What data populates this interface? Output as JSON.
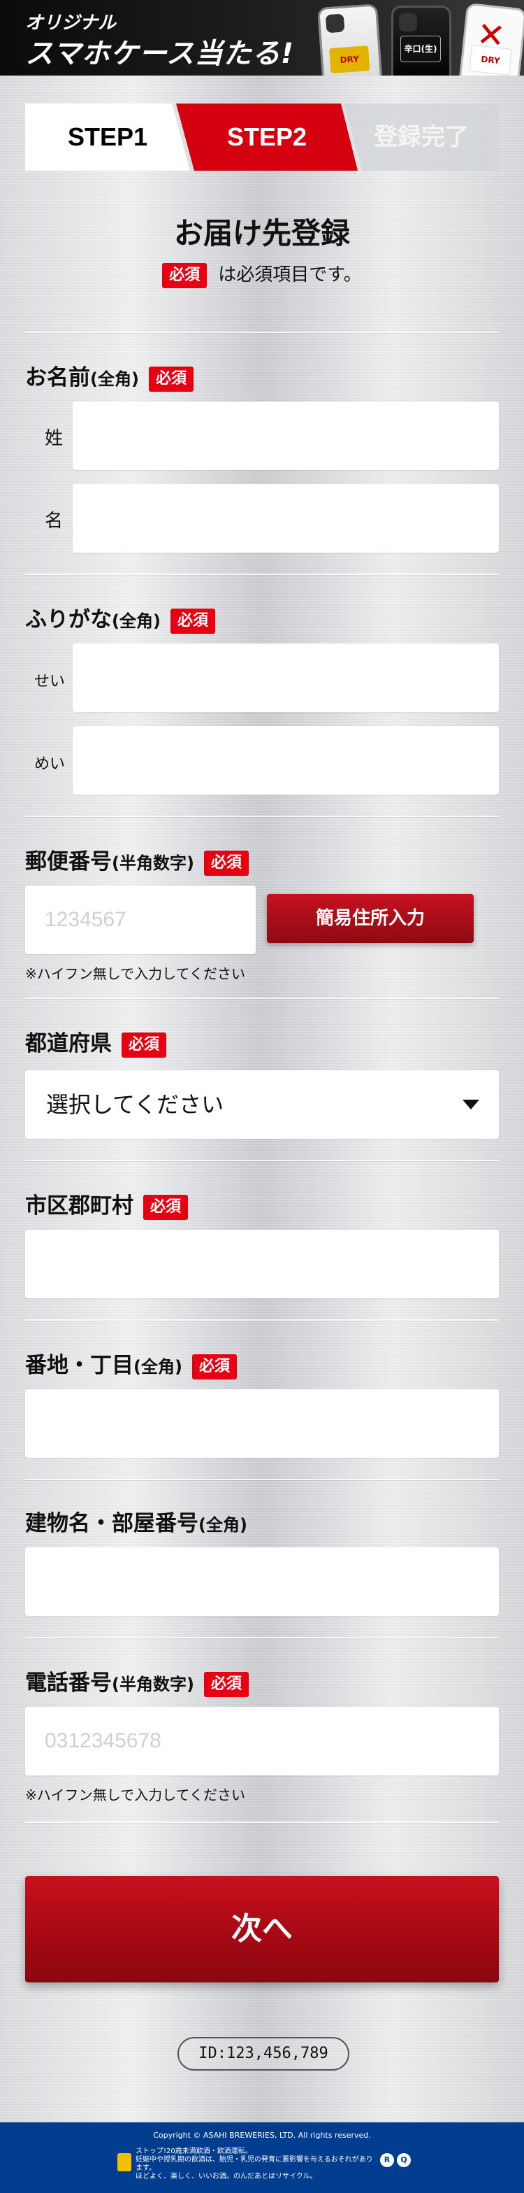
{
  "header": {
    "line1": "オリジナル",
    "line2": "スマホケース当たる!",
    "phone_labels": [
      "DRY",
      "辛口(生)",
      "DRY"
    ]
  },
  "steps": [
    {
      "label": "STEP1",
      "state": "done"
    },
    {
      "label": "STEP2",
      "state": "current"
    },
    {
      "label": "登録完了",
      "state": "pending"
    }
  ],
  "form": {
    "title": "お届け先登録",
    "required_badge": "必須",
    "required_note": "は必須項目です。",
    "name": {
      "label": "お名前",
      "sub": "(全角)",
      "last_label": "姓",
      "first_label": "名"
    },
    "furigana": {
      "label": "ふりがな",
      "sub": "(全角)",
      "last_label": "せい",
      "first_label": "めい"
    },
    "zip": {
      "label": "郵便番号",
      "sub": "(半角数字)",
      "placeholder": "1234567",
      "button": "簡易住所入力",
      "hint": "※ハイフン無しで入力してください"
    },
    "prefecture": {
      "label": "都道府県",
      "selected": "選択してください"
    },
    "city": {
      "label": "市区郡町村"
    },
    "street": {
      "label": "番地・丁目",
      "sub": "(全角)"
    },
    "building": {
      "label": "建物名・部屋番号",
      "sub": "(全角)"
    },
    "phone": {
      "label": "電話番号",
      "sub": "(半角数字)",
      "placeholder": "0312345678",
      "hint": "※ハイフン無しで入力してください"
    },
    "next_button": "次へ",
    "id_text": "ID:123,456,789"
  },
  "footer": {
    "copyright": "Copyright © ASAHI BREWERIES, LTD. All rights reserved.",
    "warning_lines": [
      "ストップ!20歳未満飲酒・飲酒運転。",
      "妊娠中や授乳期の飲酒は、胎児・乳児の発育に悪影響を与えるおそれがあります。",
      "ほどよく、楽しく、いいお酒。のんだあとはリサイクル。"
    ],
    "badge1": "R",
    "badge2": "Q"
  }
}
